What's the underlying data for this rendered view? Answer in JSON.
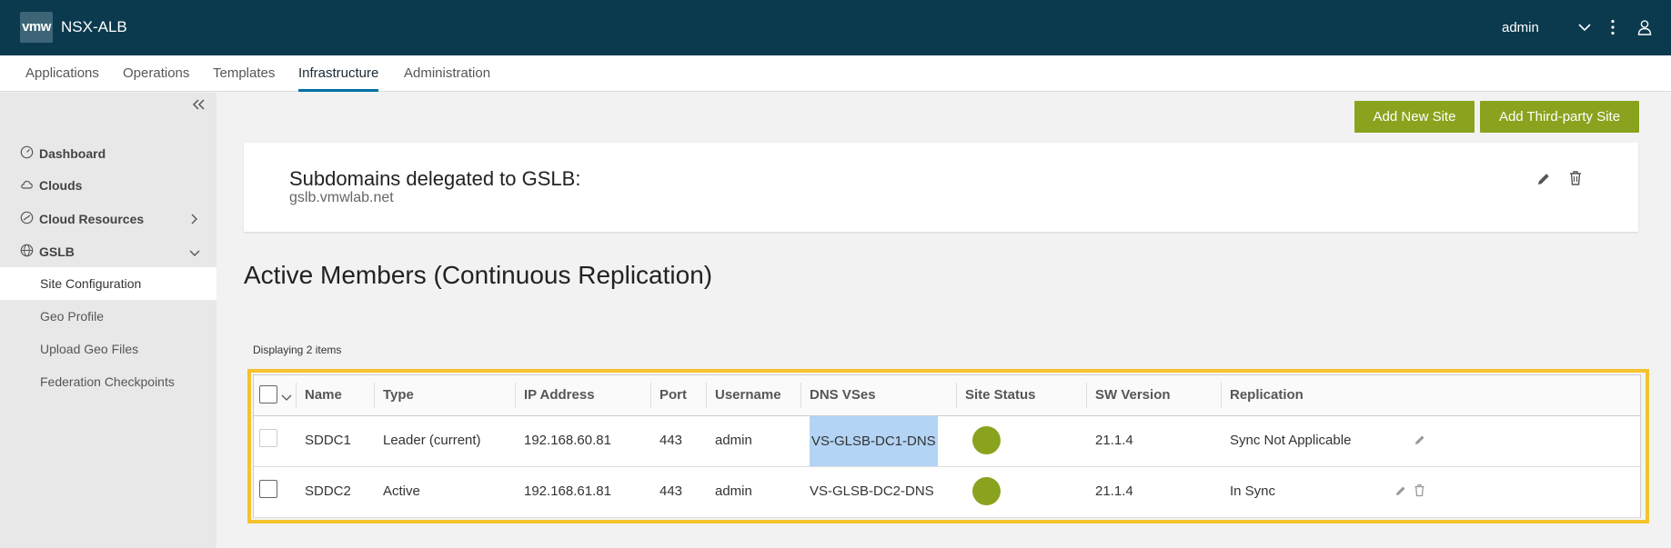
{
  "header": {
    "logo_text": "vmw",
    "app_name": "NSX-ALB",
    "user": "admin",
    "icons": [
      "chevron-down-icon",
      "more-vertical-icon",
      "user-icon"
    ],
    "bg_color": "#0b3a4e"
  },
  "nav": {
    "tabs": [
      {
        "label": "Applications",
        "active": false
      },
      {
        "label": "Operations",
        "active": false
      },
      {
        "label": "Templates",
        "active": false
      },
      {
        "label": "Infrastructure",
        "active": true
      },
      {
        "label": "Administration",
        "active": false
      }
    ],
    "accent": "#0072a3"
  },
  "sidebar": {
    "items": [
      {
        "label": "Dashboard",
        "icon": "dashboard-icon"
      },
      {
        "label": "Clouds",
        "icon": "cloud-icon"
      },
      {
        "label": "Cloud Resources",
        "icon": "cloud-resources-icon",
        "expandable": true
      },
      {
        "label": "GSLB",
        "icon": "globe-icon",
        "expanded": true
      }
    ],
    "sub_items": [
      {
        "label": "Site Configuration",
        "active": true
      },
      {
        "label": "Geo Profile",
        "active": false
      },
      {
        "label": "Upload Geo Files",
        "active": false
      },
      {
        "label": "Federation Checkpoints",
        "active": false
      }
    ]
  },
  "actions": {
    "add_new_site": "Add New Site",
    "add_third_party_site": "Add Third-party Site",
    "button_color": "#8aa31e"
  },
  "subdomains": {
    "title": "Subdomains delegated to GSLB:",
    "value": "gslb.vmwlab.net"
  },
  "members": {
    "title": "Active Members (Continuous Replication)",
    "display_count": "Displaying 2 items",
    "columns": [
      "Name",
      "Type",
      "IP Address",
      "Port",
      "Username",
      "DNS VSes",
      "Site Status",
      "SW Version",
      "Replication"
    ],
    "rows": [
      {
        "name": "SDDC1",
        "type": "Leader (current)",
        "ip": "192.168.60.81",
        "port": "443",
        "username": "admin",
        "dns_vses": "VS-GLSB-DC1-DNS",
        "site_status": "up",
        "sw_version": "21.1.4",
        "replication": "Sync Not Applicable"
      },
      {
        "name": "SDDC2",
        "type": "Active",
        "ip": "192.168.61.81",
        "port": "443",
        "username": "admin",
        "dns_vses": "VS-GLSB-DC2-DNS",
        "site_status": "up",
        "sw_version": "21.1.4",
        "replication": "In Sync"
      }
    ],
    "status_color": "#8aa31e",
    "highlight_color": "#f5c22c"
  }
}
